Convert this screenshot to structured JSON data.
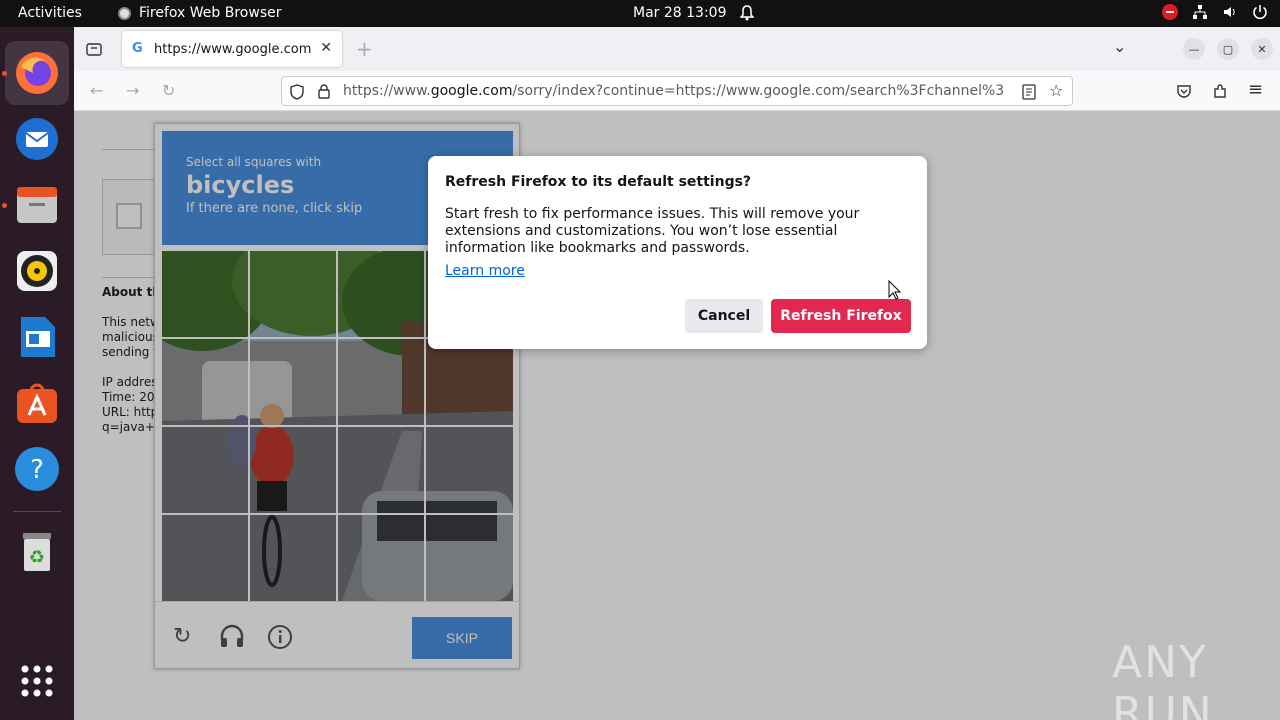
{
  "topbar": {
    "activities": "Activities",
    "app_name": "Firefox Web Browser",
    "clock": "Mar 28  13:09"
  },
  "dock": {
    "items": [
      "firefox-icon",
      "thunderbird-icon",
      "files-icon",
      "rhythmbox-icon",
      "writer-icon",
      "app-center-icon",
      "help-icon",
      "trash-icon",
      "apps-grid-icon"
    ]
  },
  "browser": {
    "tab_title": "https://www.google.com",
    "url_prefix": "https://www.",
    "url_domain": "google.com",
    "url_rest": "/sorry/index?continue=https://www.google.com/search%3Fchannel%3"
  },
  "page": {
    "about_heading": "About th",
    "para1": [
      "This netw",
      "malicious",
      "sending t"
    ],
    "para2": [
      "IP addres",
      "Time: 20",
      "URL: http",
      "q=java+t"
    ]
  },
  "captcha": {
    "instruction": "Select all squares with",
    "target": "bicycles",
    "hint": "If there are none, click skip",
    "skip_label": "SKIP"
  },
  "dialog": {
    "title": "Refresh Firefox to its default settings?",
    "body": "Start fresh to fix performance issues. This will remove your extensions and customizations. You won’t lose essential information like bookmarks and passwords.",
    "learn_more": "Learn more",
    "cancel_label": "Cancel",
    "refresh_label": "Refresh Firefox"
  },
  "colors": {
    "accent_refresh": "#e22850",
    "captcha_blue": "#4a90e2",
    "dock_bg": "#2b1b26"
  },
  "watermark": "ANY RUN"
}
